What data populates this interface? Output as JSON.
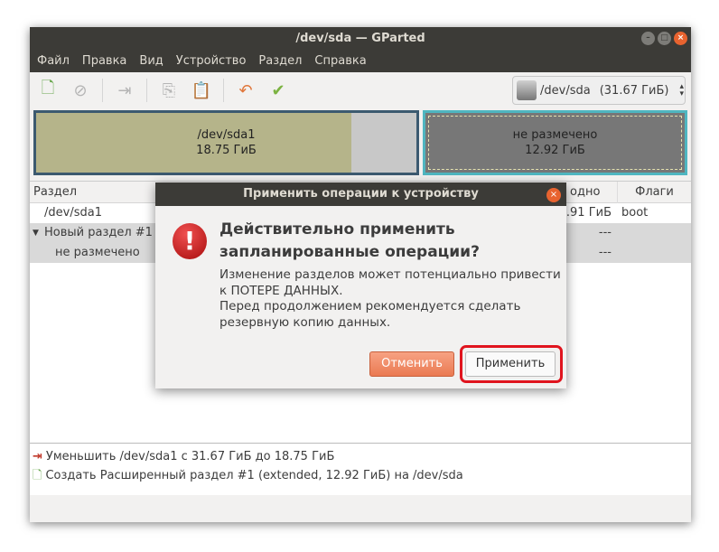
{
  "window": {
    "title": "/dev/sda — GParted"
  },
  "menu": [
    "Файл",
    "Правка",
    "Вид",
    "Устройство",
    "Раздел",
    "Справка"
  ],
  "device": {
    "name": "/dev/sda",
    "size": "(31.67 ГиБ)"
  },
  "diskmap": {
    "p1": {
      "name": "/dev/sda1",
      "size": "18.75 ГиБ",
      "used_fraction": 0.83
    },
    "p2": {
      "name": "не размечено",
      "size": "12.92 ГиБ"
    }
  },
  "table": {
    "headers": {
      "partition": "Раздел",
      "free": "одно",
      "flags": "Флаги"
    },
    "rows": [
      {
        "partition": "/dev/sda1",
        "free": "2.91 ГиБ",
        "flags": "boot"
      },
      {
        "partition": "Новый раздел #1",
        "free": "---",
        "flags": ""
      },
      {
        "partition": "не размечено",
        "free": "---",
        "flags": ""
      }
    ]
  },
  "operations": [
    "Уменьшить /dev/sda1 с 31.67 ГиБ до 18.75 ГиБ",
    "Создать Расширенный раздел #1 (extended, 12.92 ГиБ) на /dev/sda"
  ],
  "dialog": {
    "title": "Применить операции к устройству",
    "heading1": "Действительно применить",
    "heading2": "запланированные операции?",
    "body": [
      "Изменение разделов может потенциально привести",
      "к ПОТЕРЕ ДАННЫХ.",
      "Перед продолжением рекомендуется сделать",
      "резервную копию данных."
    ],
    "cancel": "Отменить",
    "apply": "Применить"
  }
}
